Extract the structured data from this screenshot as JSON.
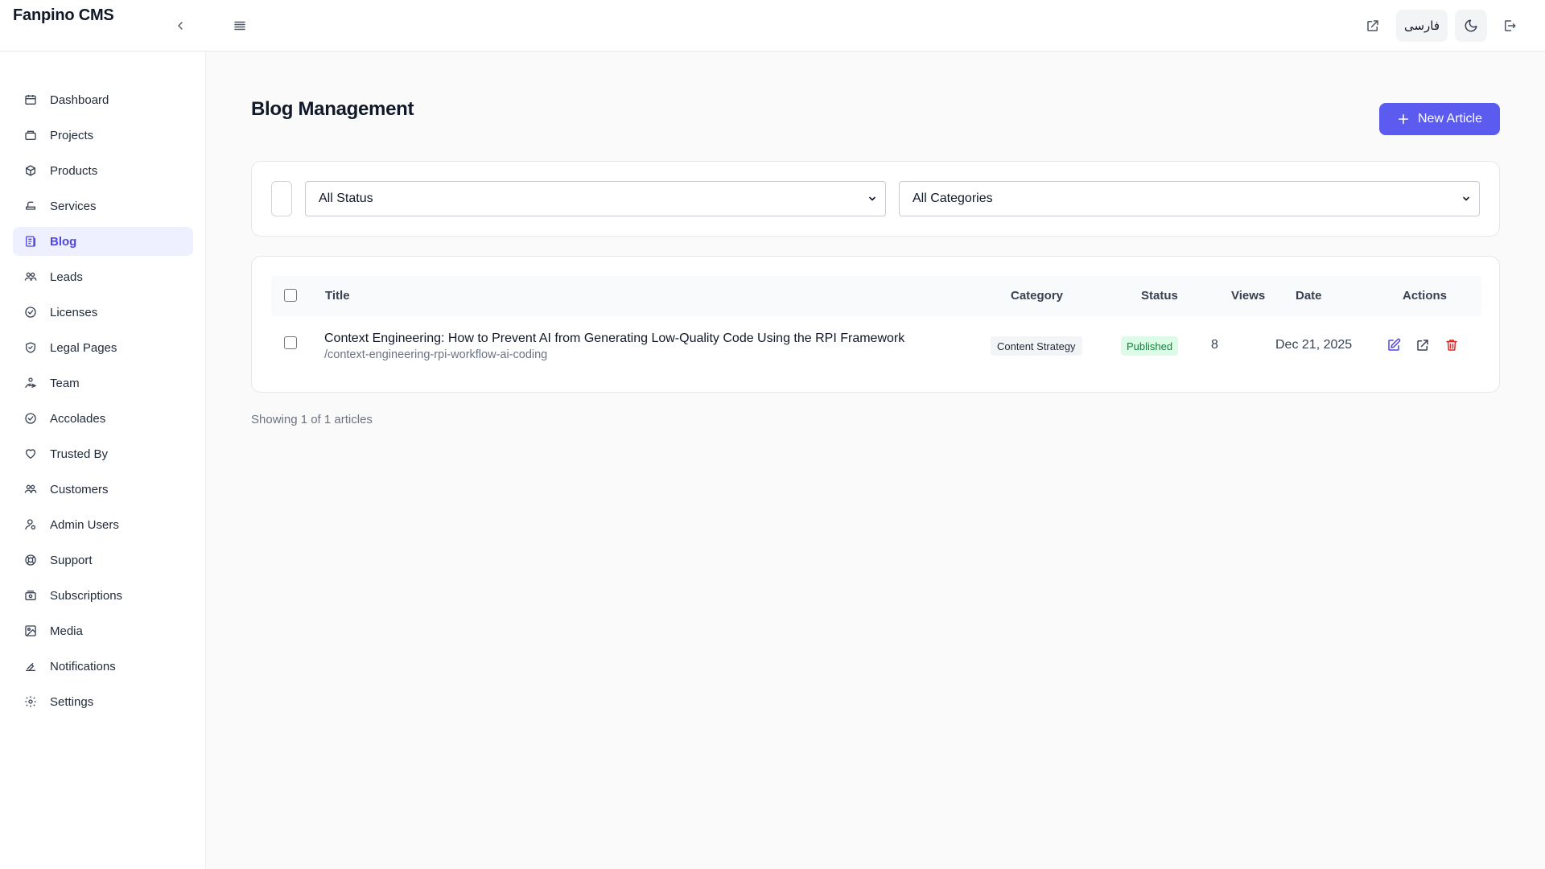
{
  "app": {
    "brand": "Fanpino CMS"
  },
  "topbar": {
    "language_label": "فارسی"
  },
  "sidebar": {
    "items": [
      {
        "label": "Dashboard",
        "icon": "dashboard-icon"
      },
      {
        "label": "Projects",
        "icon": "projects-icon"
      },
      {
        "label": "Products",
        "icon": "products-icon"
      },
      {
        "label": "Services",
        "icon": "services-icon"
      },
      {
        "label": "Blog",
        "icon": "blog-icon",
        "active": true
      },
      {
        "label": "Leads",
        "icon": "leads-icon"
      },
      {
        "label": "Licenses",
        "icon": "licenses-icon"
      },
      {
        "label": "Legal Pages",
        "icon": "legal-pages-icon"
      },
      {
        "label": "Team",
        "icon": "team-icon"
      },
      {
        "label": "Accolades",
        "icon": "accolades-icon"
      },
      {
        "label": "Trusted By",
        "icon": "trusted-by-icon"
      },
      {
        "label": "Customers",
        "icon": "customers-icon"
      },
      {
        "label": "Admin Users",
        "icon": "admin-users-icon"
      },
      {
        "label": "Support",
        "icon": "support-icon"
      },
      {
        "label": "Subscriptions",
        "icon": "subscriptions-icon"
      },
      {
        "label": "Media",
        "icon": "media-icon"
      },
      {
        "label": "Notifications",
        "icon": "notifications-icon"
      },
      {
        "label": "Settings",
        "icon": "settings-icon"
      }
    ]
  },
  "main": {
    "title": "Blog Management",
    "new_button_label": "New Article",
    "filters": {
      "status_selected": "All Status",
      "category_selected": "All Categories"
    },
    "table": {
      "columns": [
        "Title",
        "Category",
        "Status",
        "Views",
        "Date",
        "Actions"
      ],
      "rows": [
        {
          "title": "Context Engineering: How to Prevent AI from Generating Low-Quality Code Using the RPI Framework",
          "slug": "/context-engineering-rpi-workflow-ai-coding",
          "category": "Content Strategy",
          "status": "Published",
          "views": "8",
          "date": "Dec 21, 2025"
        }
      ]
    },
    "footer_text": "Showing 1 of 1 articles"
  },
  "colors": {
    "accent": "#5b5bf0",
    "active_nav_bg": "#eef0ff",
    "active_nav_text": "#4f46e5",
    "status_published_bg": "#dcfce7",
    "status_published_text": "#15803d",
    "delete": "#dc2626"
  }
}
